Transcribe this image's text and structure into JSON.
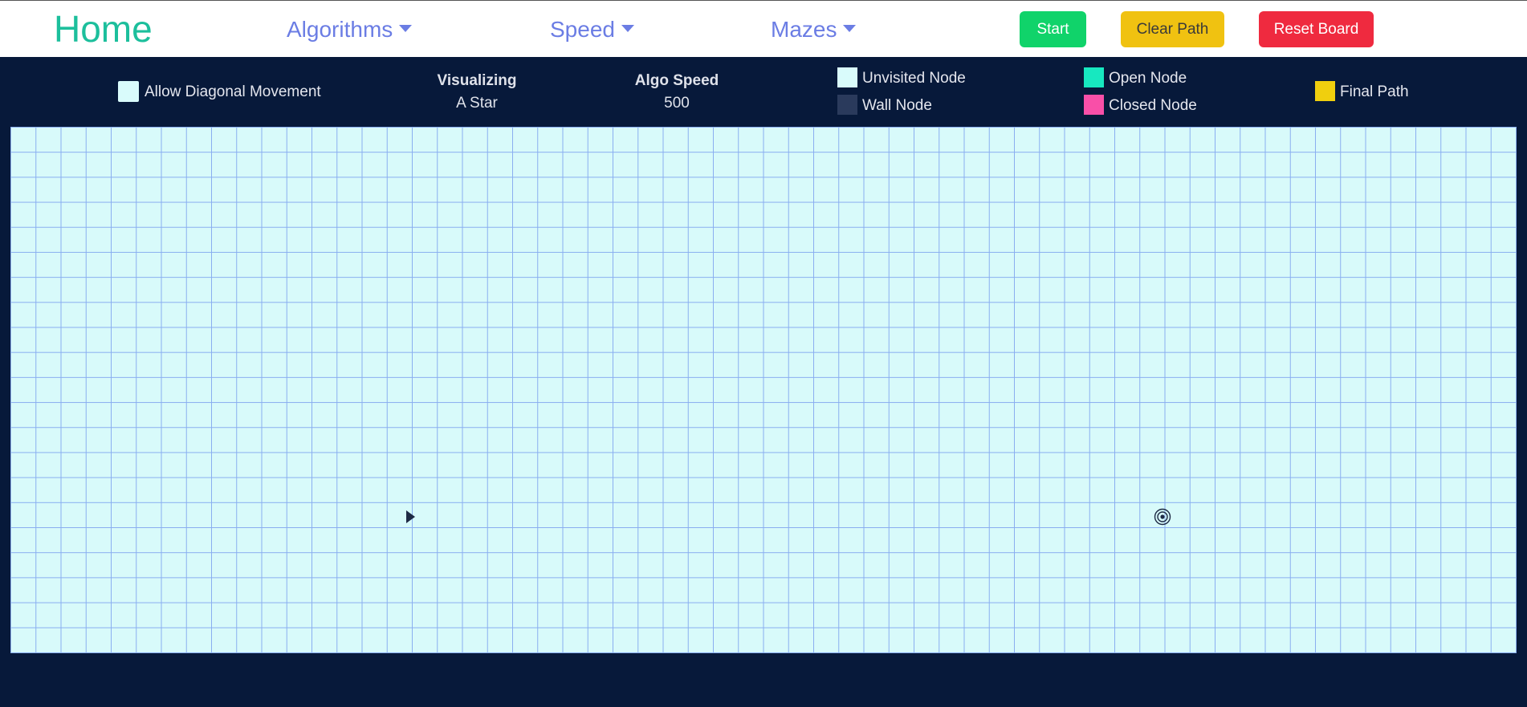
{
  "nav": {
    "home_label": "Home",
    "algorithms_label": "Algorithms",
    "speed_label": "Speed",
    "mazes_label": "Mazes",
    "start_label": "Start",
    "clear_path_label": "Clear Path",
    "reset_board_label": "Reset Board"
  },
  "options": {
    "diagonal_label": "Allow Diagonal Movement",
    "diagonal_checked": false
  },
  "status": {
    "visualizing_label": "Visualizing",
    "visualizing_value": "A Star",
    "speed_label": "Algo Speed",
    "speed_value": "500"
  },
  "legend": {
    "unvisited": {
      "label": "Unvisited Node",
      "color": "#d9fbfb"
    },
    "wall": {
      "label": "Wall Node",
      "color": "#2a3a5c"
    },
    "open": {
      "label": "Open Node",
      "color": "#17e8c0"
    },
    "closed": {
      "label": "Closed Node",
      "color": "#f94fa8"
    },
    "final": {
      "label": "Final Path",
      "color": "#f0cf0e"
    }
  },
  "board": {
    "columns": 60,
    "rows": 21,
    "start_icon": "play-triangle-icon",
    "target_icon": "target-bullseye-icon",
    "cell_color": "#d8fafa",
    "grid_line_color": "#89aef0"
  },
  "colors": {
    "home": "#1cbf9c",
    "nav_link": "#6b7de4",
    "start_button": "#10d36a",
    "clear_button": "#f0c211",
    "reset_button": "#ef2a3f",
    "background": "#07193a"
  }
}
